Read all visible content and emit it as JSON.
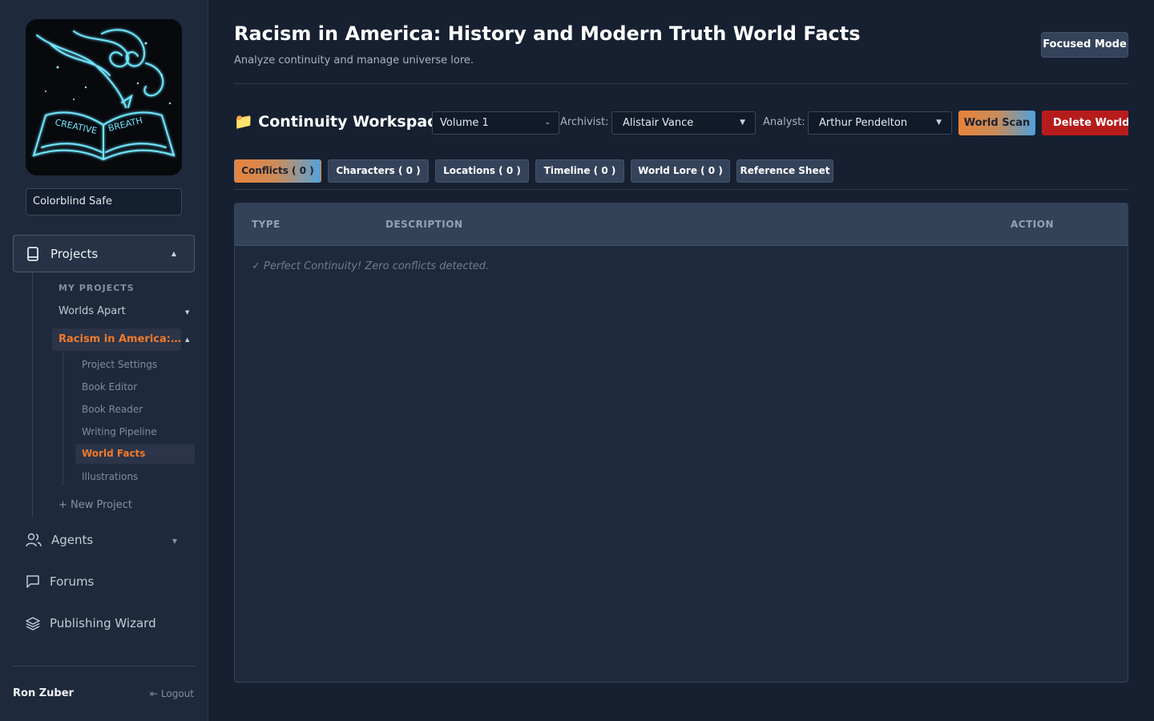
{
  "sidebar": {
    "logo_words": [
      "CREATIVE",
      "BREATH"
    ],
    "theme_select": "Colorblind Safe",
    "projects_label": "Projects",
    "my_projects_heading": "MY PROJECTS",
    "project_items": [
      {
        "label": "Worlds Apart"
      },
      {
        "label": "Racism in America: History and Modern Truth"
      }
    ],
    "sub_items": [
      {
        "label": "Project Settings"
      },
      {
        "label": "Book Editor"
      },
      {
        "label": "Book Reader"
      },
      {
        "label": "Writing Pipeline"
      },
      {
        "label": "World Facts"
      },
      {
        "label": "Illustrations"
      }
    ],
    "new_project": "+ New Project",
    "agents_label": "Agents",
    "forums_label": "Forums",
    "publishing_label": "Publishing Wizard",
    "user_name": "Ron Zuber",
    "logout_label": "Logout"
  },
  "header": {
    "title": "Racism in America: History and Modern Truth World Facts",
    "subtitle": "Analyze continuity and manage universe lore.",
    "focused_mode": "Focused Mode"
  },
  "toolbar": {
    "workspace_title": "Continuity Workspace",
    "volume_value": "Volume 1",
    "archivist_label": "Archivist:",
    "archivist_value": "Alistair Vance",
    "analyst_label": "Analyst:",
    "analyst_value": "Arthur Pendelton",
    "scan_label": "World Scan",
    "delete_label": "Delete World Facts"
  },
  "tabs": [
    {
      "label": "Conflicts (  0  )",
      "active": true
    },
    {
      "label": "Characters (  0  )",
      "active": false
    },
    {
      "label": "Locations (  0  )",
      "active": false
    },
    {
      "label": "Timeline (  0  )",
      "active": false
    },
    {
      "label": "World Lore (  0  )",
      "active": false
    },
    {
      "label": "Reference Sheet",
      "active": false
    }
  ],
  "table": {
    "columns": [
      "TYPE",
      "DESCRIPTION",
      "ACTION"
    ],
    "empty_message": "✓ Perfect Continuity! Zero conflicts detected."
  },
  "colors": {
    "accent": "#f07a2a",
    "danger": "#b71c1c",
    "bg": "#162031",
    "sidebar_bg": "#1e2a3b"
  }
}
